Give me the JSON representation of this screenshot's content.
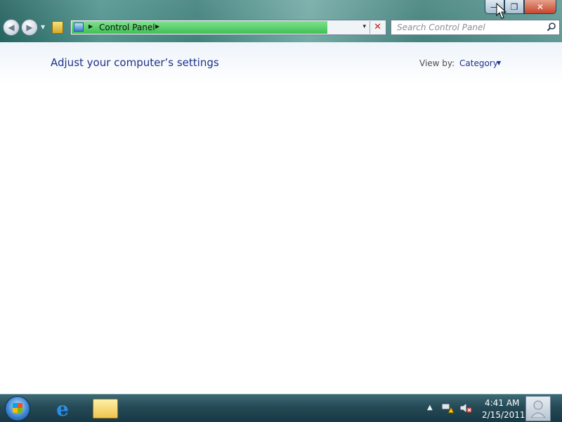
{
  "window": {
    "caption_buttons": {
      "minimize": "—",
      "restore": "❐",
      "close": "✕"
    }
  },
  "nav": {
    "address": {
      "breadcrumb": "Control Panel",
      "dropdown_glyph": "▾",
      "stop_glyph": "✕"
    },
    "search": {
      "placeholder": "Search Control Panel"
    }
  },
  "content": {
    "title": "Adjust your computer’s settings",
    "view_by_label": "View by:",
    "view_by_value": "Category"
  },
  "taskbar": {
    "ie_glyph": "e",
    "tray": {
      "time": "4:41 AM",
      "date": "2/15/2011"
    }
  },
  "colors": {
    "link_blue": "#1e3287",
    "address_progress": "#3fbf55",
    "taskbar": "#244a56"
  }
}
